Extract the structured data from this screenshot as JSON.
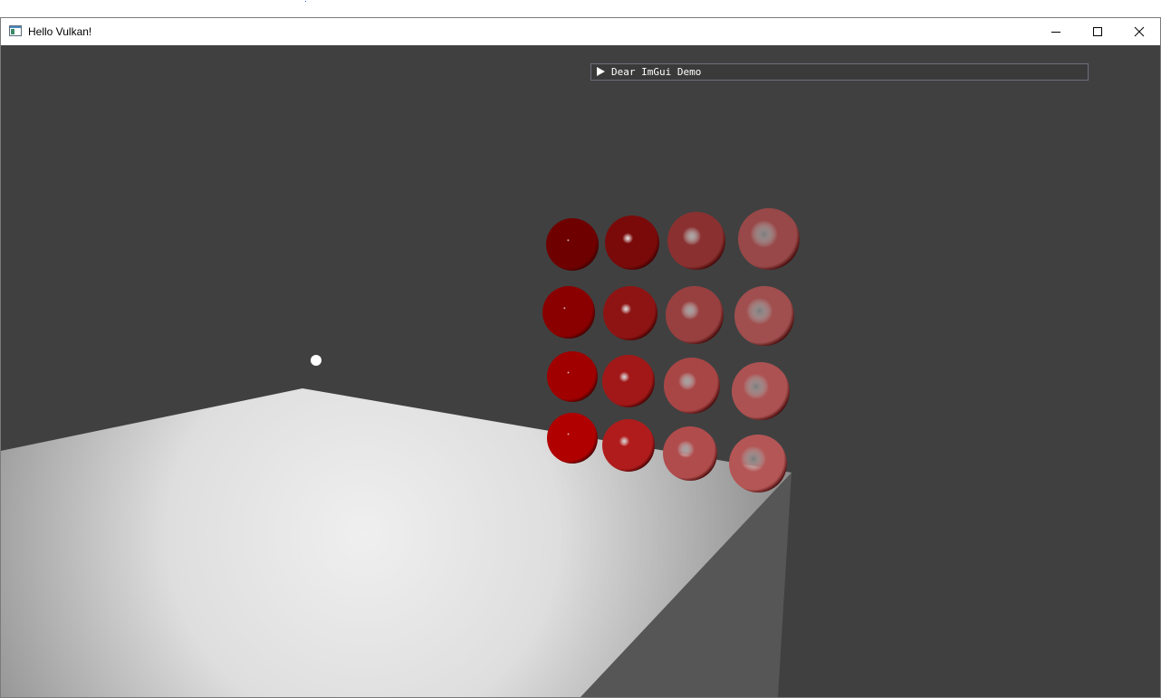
{
  "window": {
    "title": "Hello Vulkan!",
    "controls": [
      "minimize",
      "maximize",
      "close"
    ]
  },
  "scene": {
    "background_color": "#404040",
    "floor_color": "#e8e8e8",
    "sphere_color": "#b01010",
    "light_color": "#ffffff",
    "sphere_grid": {
      "rows": 4,
      "columns": 4
    }
  },
  "imgui": {
    "window_title": "Dear ImGui Demo",
    "collapsed": true
  },
  "icons": {
    "app": "app-window-icon",
    "minimize": "minimize-icon",
    "maximize": "maximize-icon",
    "close": "close-icon",
    "collapse": "collapse-arrow-icon"
  }
}
